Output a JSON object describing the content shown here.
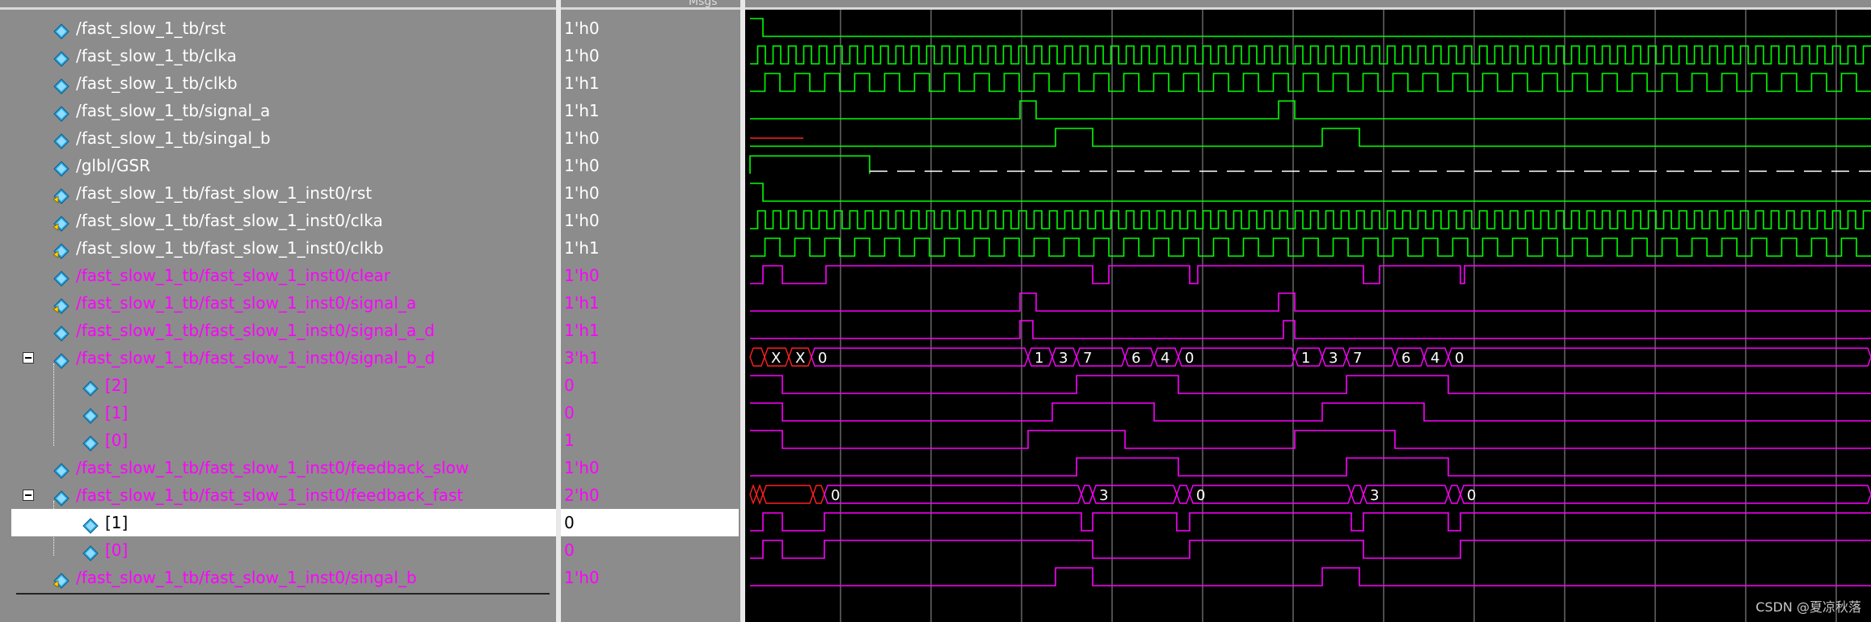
{
  "header": {
    "value_col_tail": "Msgs"
  },
  "signals": [
    {
      "name": "/fast_slow_1_tb/rst",
      "value": "1'h0",
      "color": "white",
      "icon": "input-signal-icon",
      "indent": 0
    },
    {
      "name": "/fast_slow_1_tb/clka",
      "value": "1'h0",
      "color": "white",
      "icon": "input-signal-icon",
      "indent": 0
    },
    {
      "name": "/fast_slow_1_tb/clkb",
      "value": "1'h1",
      "color": "white",
      "icon": "input-signal-icon",
      "indent": 0
    },
    {
      "name": "/fast_slow_1_tb/signal_a",
      "value": "1'h1",
      "color": "white",
      "icon": "input-signal-icon",
      "indent": 0
    },
    {
      "name": "/fast_slow_1_tb/singal_b",
      "value": "1'h0",
      "color": "white",
      "icon": "input-signal-icon",
      "indent": 0
    },
    {
      "name": "/glbl/GSR",
      "value": "1'h0",
      "color": "white",
      "icon": "input-signal-icon",
      "indent": 0
    },
    {
      "name": "/fast_slow_1_tb/fast_slow_1_inst0/rst",
      "value": "1'h0",
      "color": "white",
      "icon": "port-signal-icon",
      "indent": 0
    },
    {
      "name": "/fast_slow_1_tb/fast_slow_1_inst0/clka",
      "value": "1'h0",
      "color": "white",
      "icon": "port-signal-icon",
      "indent": 0
    },
    {
      "name": "/fast_slow_1_tb/fast_slow_1_inst0/clkb",
      "value": "1'h1",
      "color": "white",
      "icon": "port-signal-icon",
      "indent": 0
    },
    {
      "name": "/fast_slow_1_tb/fast_slow_1_inst0/clear",
      "value": "1'h0",
      "color": "magenta",
      "icon": "input-signal-icon",
      "indent": 0
    },
    {
      "name": "/fast_slow_1_tb/fast_slow_1_inst0/signal_a",
      "value": "1'h1",
      "color": "magenta",
      "icon": "port-signal-icon",
      "indent": 0
    },
    {
      "name": "/fast_slow_1_tb/fast_slow_1_inst0/signal_a_d",
      "value": "1'h1",
      "color": "magenta",
      "icon": "input-signal-icon",
      "indent": 0
    },
    {
      "name": "/fast_slow_1_tb/fast_slow_1_inst0/signal_b_d",
      "value": "3'h1",
      "color": "magenta",
      "icon": "input-signal-icon",
      "indent": 0,
      "expander": true
    },
    {
      "name": "[2]",
      "value": "0",
      "color": "magenta",
      "icon": "input-signal-icon",
      "indent": 1
    },
    {
      "name": "[1]",
      "value": "0",
      "color": "magenta",
      "icon": "input-signal-icon",
      "indent": 1
    },
    {
      "name": "[0]",
      "value": "1",
      "color": "magenta",
      "icon": "input-signal-icon",
      "indent": 1
    },
    {
      "name": "/fast_slow_1_tb/fast_slow_1_inst0/feedback_slow",
      "value": "1'h0",
      "color": "magenta",
      "icon": "input-signal-icon",
      "indent": 0
    },
    {
      "name": "/fast_slow_1_tb/fast_slow_1_inst0/feedback_fast",
      "value": "2'h0",
      "color": "magenta",
      "icon": "input-signal-icon",
      "indent": 0,
      "expander": true
    },
    {
      "name": "[1]",
      "value": "0",
      "color": "black",
      "icon": "input-signal-icon",
      "indent": 1,
      "selected": true
    },
    {
      "name": "[0]",
      "value": "0",
      "color": "magenta",
      "icon": "input-signal-icon",
      "indent": 1
    },
    {
      "name": "/fast_slow_1_tb/fast_slow_1_inst0/singal_b",
      "value": "1'h0",
      "color": "magenta",
      "icon": "port-signal-icon",
      "indent": 0
    }
  ],
  "bus_labels": {
    "signal_b_d": [
      "X",
      "X",
      "0",
      "1",
      "3",
      "7",
      "6",
      "4",
      "0",
      "1",
      "3",
      "7",
      "6",
      "4",
      "0"
    ],
    "feedback_fast": [
      "0",
      "3",
      "0",
      "3",
      "0"
    ]
  },
  "colors": {
    "green": "#00ff00",
    "magenta": "#ff00ff",
    "red": "#ff2020",
    "white": "#ffffff",
    "gridline": "#9a9a9a"
  },
  "watermark": "CSDN @夏凉秋落"
}
